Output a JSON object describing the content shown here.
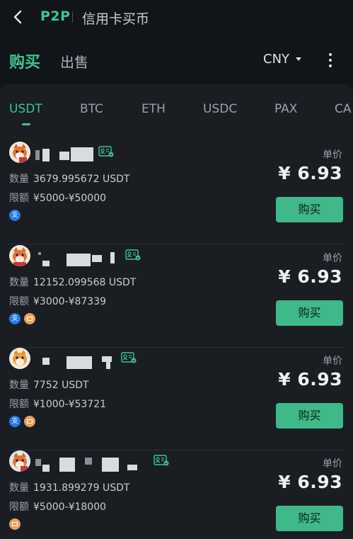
{
  "header": {
    "brand": "P2P",
    "title": "信用卡买币"
  },
  "mode": {
    "buy": "购买",
    "sell": "出售",
    "currency": "CNY"
  },
  "coins": [
    "USDT",
    "BTC",
    "ETH",
    "USDC",
    "PAX",
    "CA"
  ],
  "labels": {
    "quantity": "数量",
    "limit": "限额",
    "unit_price": "单价",
    "buy_button": "购买",
    "alipay_glyph": "支"
  },
  "offers": [
    {
      "quantity": "3679.995672 USDT",
      "limit": "¥5000-¥50000",
      "price": "¥ 6.93",
      "payments": [
        "alipay"
      ]
    },
    {
      "quantity": "12152.099568 USDT",
      "limit": "¥3000-¥87339",
      "price": "¥ 6.93",
      "payments": [
        "alipay",
        "bank"
      ]
    },
    {
      "quantity": "7752 USDT",
      "limit": "¥1000-¥53721",
      "price": "¥ 6.93",
      "payments": [
        "alipay",
        "bank"
      ]
    },
    {
      "quantity": "1931.899279 USDT",
      "limit": "¥5000-¥18000",
      "price": "¥ 6.93",
      "payments": [
        "bank"
      ]
    }
  ],
  "colors": {
    "accent": "#3fc48f",
    "button": "#3fb88a",
    "background": "#111519",
    "panel": "#1a1e23"
  },
  "icons": [
    "back-icon",
    "more-icon",
    "verified-merchant-icon",
    "alipay-icon",
    "bank-card-icon"
  ]
}
